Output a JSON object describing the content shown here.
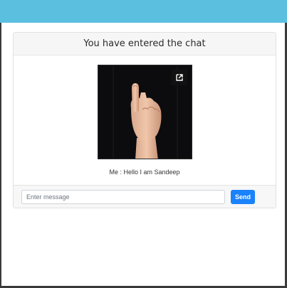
{
  "chat": {
    "title": "You have entered the chat"
  },
  "media": {
    "icon": "open-in-new-icon"
  },
  "messages": [
    {
      "text": "Me : Hello I am Sandeep"
    }
  ],
  "composer": {
    "placeholder": "Enter message",
    "value": "",
    "send_label": "Send"
  },
  "colors": {
    "topbar": "#5bbfdf",
    "send_button": "#1a82fb"
  }
}
